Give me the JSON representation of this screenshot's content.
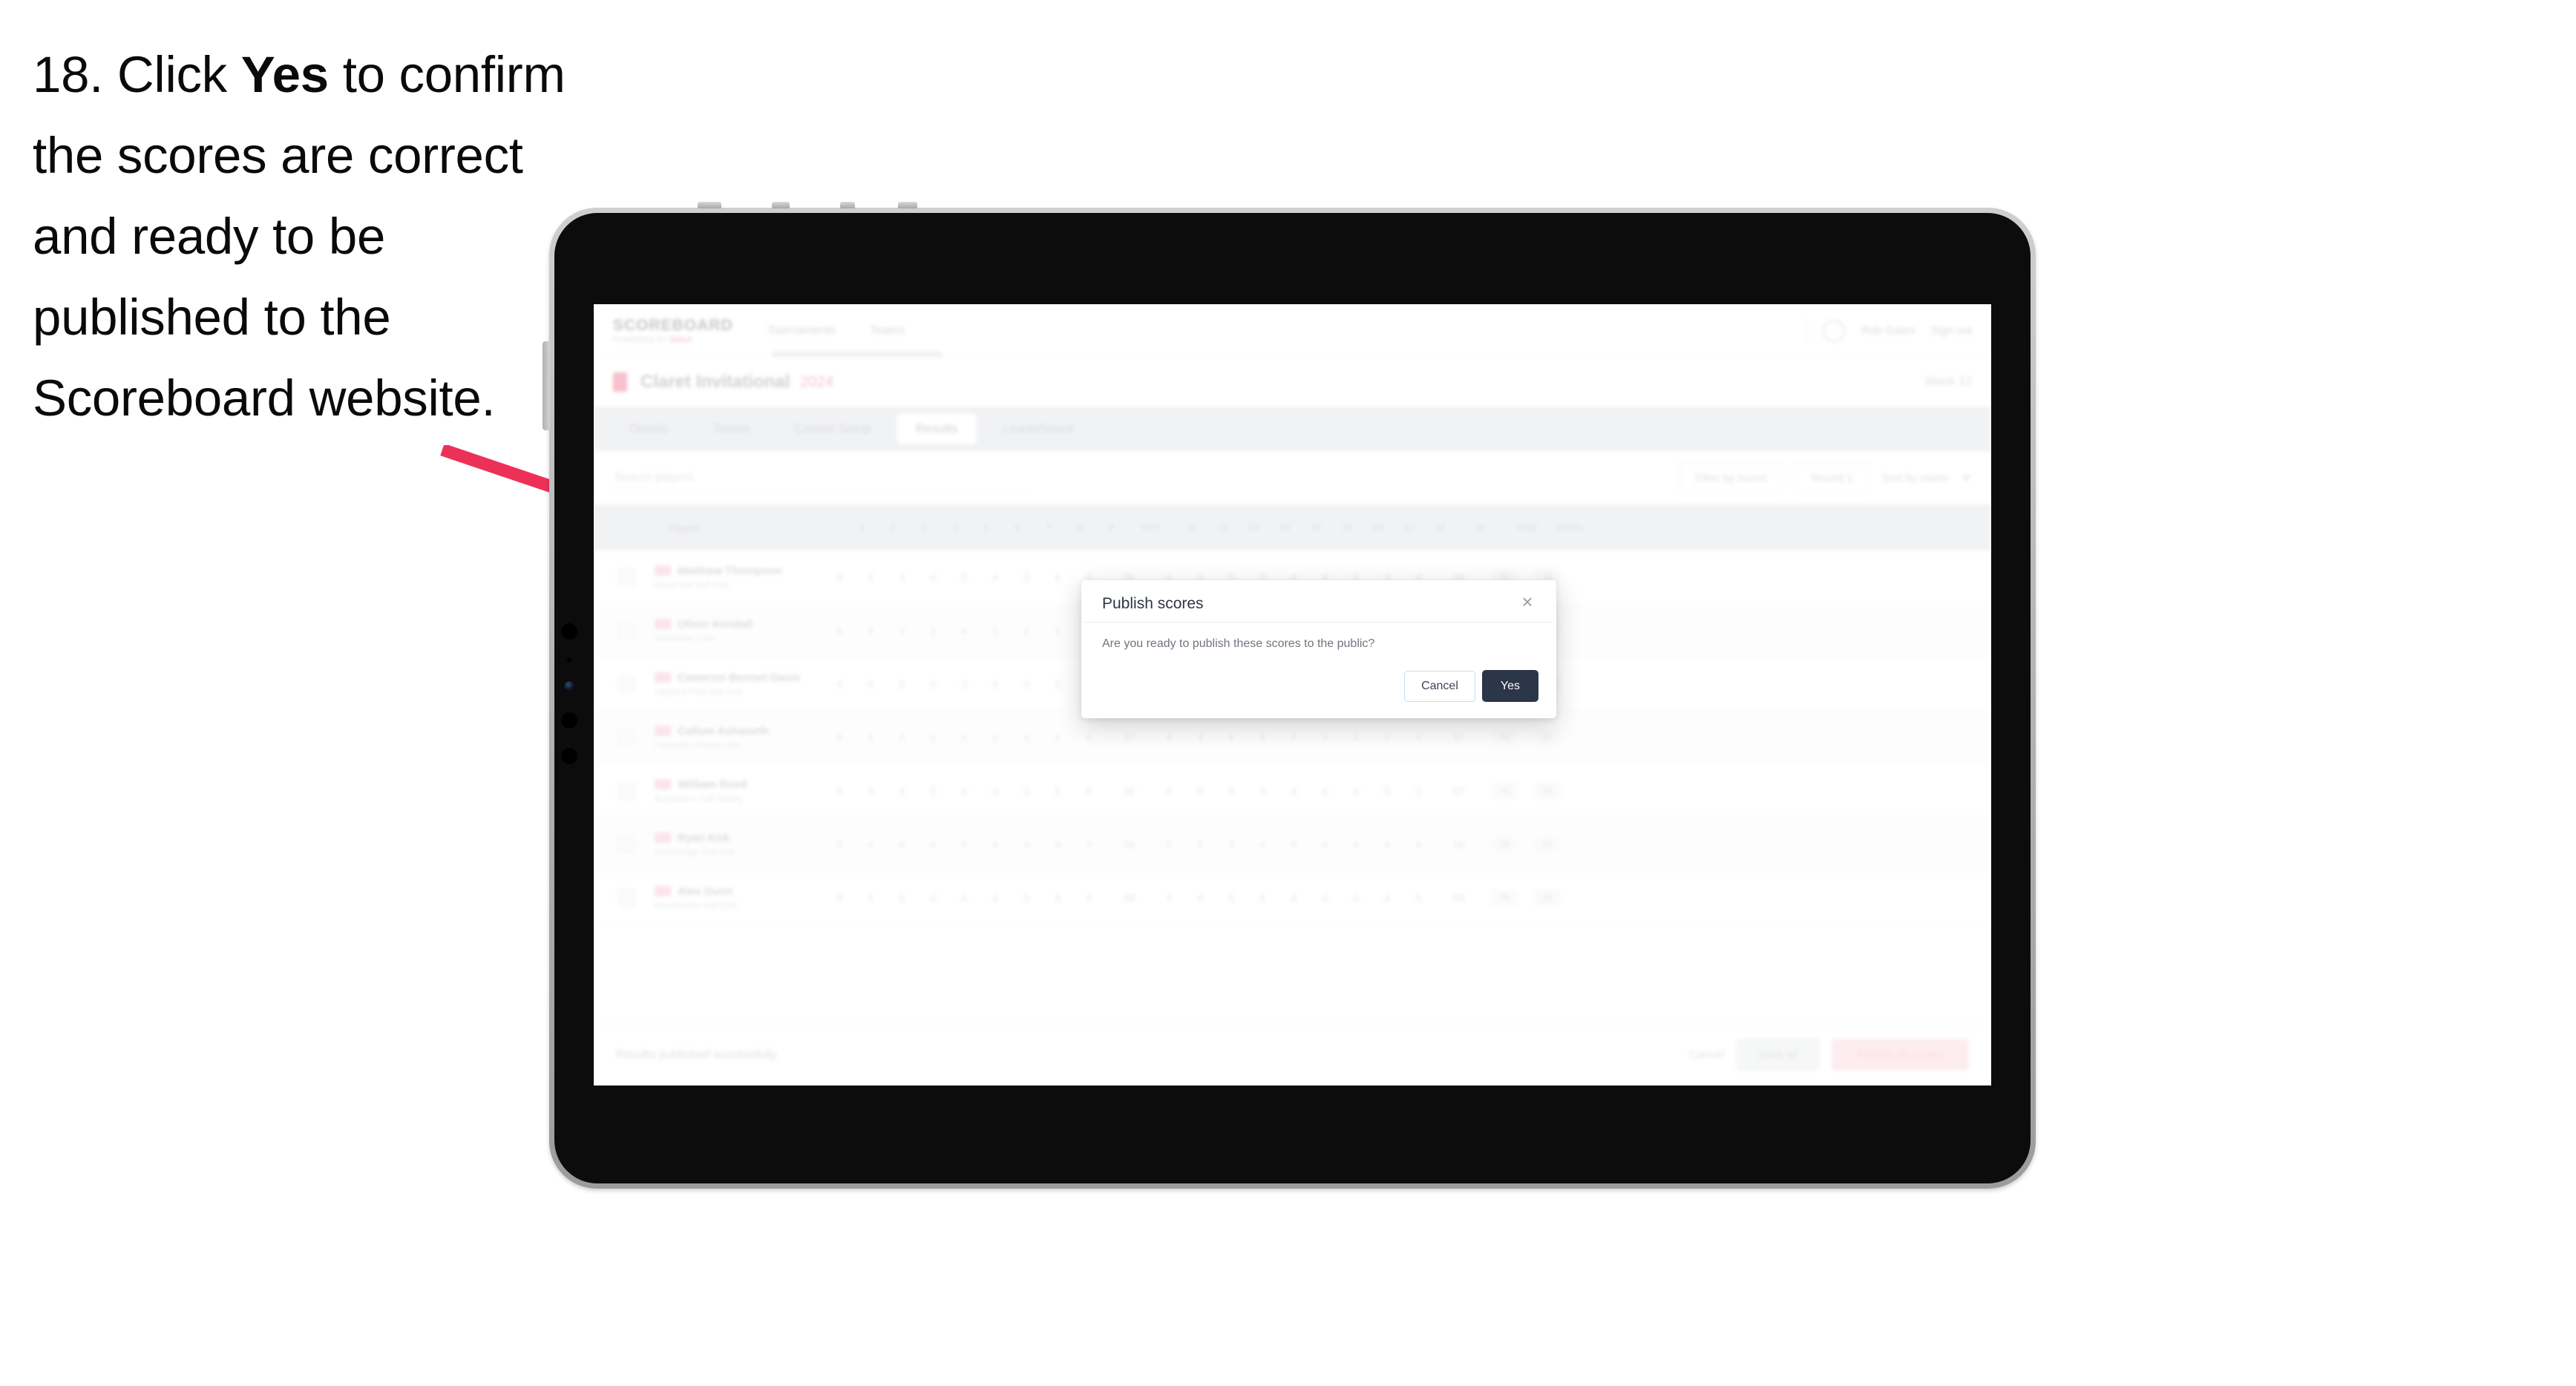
{
  "instruction": {
    "prefix": "18. Click ",
    "bold": "Yes",
    "suffix": " to confirm the scores are correct and ready to be published to the Scoreboard website."
  },
  "annotation": {
    "arrow_color": "#ED3058",
    "arrow_name": "pink-pointer-arrow"
  },
  "device": {
    "frame_color": "#b8b8b8",
    "bezel_color": "#0c0c0c"
  },
  "app": {
    "header": {
      "brand_title": "SCOREBOARD",
      "brand_sub_pre": "POWERED BY ",
      "brand_sub_accent": "GOLF",
      "nav": [
        {
          "label": "Tournaments"
        },
        {
          "label": "Teams"
        }
      ],
      "right": [
        {
          "label": "Rob Gates"
        },
        {
          "label": "Sign out"
        }
      ]
    },
    "event": {
      "name": "Claret Invitational",
      "date": "2024",
      "right_label": "Week 12"
    },
    "tabs": [
      {
        "label": "Details",
        "active": false
      },
      {
        "label": "Teams",
        "active": false
      },
      {
        "label": "Course Setup",
        "active": false
      },
      {
        "label": "Results",
        "active": true
      },
      {
        "label": "Leaderboard",
        "active": false
      }
    ],
    "filters": {
      "search_placeholder": "Search players",
      "select_one": "Filter by round",
      "select_two": "Round 1",
      "sort_label": "Sort by name"
    },
    "table": {
      "columns": [
        {
          "label": "",
          "kind": "sel"
        },
        {
          "label": "Player",
          "kind": "player"
        },
        {
          "label": "1",
          "kind": "hole"
        },
        {
          "label": "2",
          "kind": "hole"
        },
        {
          "label": "3",
          "kind": "hole"
        },
        {
          "label": "4",
          "kind": "hole"
        },
        {
          "label": "5",
          "kind": "hole"
        },
        {
          "label": "6",
          "kind": "hole"
        },
        {
          "label": "7",
          "kind": "hole"
        },
        {
          "label": "8",
          "kind": "hole"
        },
        {
          "label": "9",
          "kind": "hole"
        },
        {
          "label": "OUT",
          "kind": "wide"
        },
        {
          "label": "10",
          "kind": "hole"
        },
        {
          "label": "11",
          "kind": "hole"
        },
        {
          "label": "12",
          "kind": "hole"
        },
        {
          "label": "13",
          "kind": "hole"
        },
        {
          "label": "14",
          "kind": "hole"
        },
        {
          "label": "15",
          "kind": "hole"
        },
        {
          "label": "16",
          "kind": "hole"
        },
        {
          "label": "17",
          "kind": "hole"
        },
        {
          "label": "18",
          "kind": "hole"
        },
        {
          "label": "IN",
          "kind": "wide"
        },
        {
          "label": "Total",
          "kind": "score"
        },
        {
          "label": "Points",
          "kind": "score"
        }
      ],
      "rows": [
        {
          "name": "Matthew Thompson",
          "club": "Royal Oak Golf Club",
          "holes": [
            "4",
            "5",
            "3",
            "4",
            "5",
            "4",
            "3",
            "4",
            "4"
          ],
          "out": "36",
          "holes_in": [
            "4",
            "4",
            "5",
            "3",
            "4",
            "4",
            "5",
            "3",
            "4"
          ],
          "in": "36",
          "total": "72",
          "points": "36"
        },
        {
          "name": "Oliver Kendall",
          "club": "Westbrook Links",
          "holes": [
            "5",
            "4",
            "4",
            "3",
            "4",
            "5",
            "4",
            "3",
            "5"
          ],
          "out": "37",
          "holes_in": [
            "4",
            "5",
            "4",
            "4",
            "3",
            "5",
            "4",
            "4",
            "3"
          ],
          "in": "36",
          "total": "73",
          "points": "34"
        },
        {
          "name": "Cameron Bennet-Davis",
          "club": "Highland Park Golf Club",
          "holes": [
            "4",
            "4",
            "5",
            "4",
            "3",
            "4",
            "4",
            "5",
            "4"
          ],
          "out": "37",
          "holes_in": [
            "5",
            "4",
            "3",
            "4",
            "4",
            "4",
            "5",
            "4",
            "4"
          ],
          "in": "37",
          "total": "74",
          "points": "32"
        },
        {
          "name": "Callum Ashworth",
          "club": "Fairhaven Country Club",
          "holes": [
            "3",
            "5",
            "4",
            "4",
            "4",
            "5",
            "4",
            "4",
            "4"
          ],
          "out": "37",
          "holes_in": [
            "4",
            "4",
            "4",
            "5",
            "4",
            "3",
            "4",
            "5",
            "4"
          ],
          "in": "37",
          "total": "74",
          "points": "31"
        },
        {
          "name": "William Reed",
          "club": "Brambleton Golf Society",
          "holes": [
            "4",
            "4",
            "4",
            "5",
            "4",
            "4",
            "3",
            "5",
            "5"
          ],
          "out": "38",
          "holes_in": [
            "4",
            "5",
            "4",
            "4",
            "4",
            "4",
            "4",
            "5",
            "3"
          ],
          "in": "37",
          "total": "75",
          "points": "29"
        },
        {
          "name": "Ryan Kirk",
          "club": "Stonebridge Golf Club",
          "holes": [
            "5",
            "4",
            "4",
            "4",
            "5",
            "4",
            "4",
            "4",
            "4"
          ],
          "out": "38",
          "holes_in": [
            "5",
            "4",
            "4",
            "4",
            "5",
            "4",
            "4",
            "4",
            "4"
          ],
          "in": "38",
          "total": "76",
          "points": "27"
        },
        {
          "name": "Alex Dunn",
          "club": "Meadowvale Golf Club",
          "holes": [
            "4",
            "5",
            "5",
            "4",
            "4",
            "4",
            "5",
            "4",
            "4"
          ],
          "out": "39",
          "holes_in": [
            "4",
            "4",
            "5",
            "5",
            "4",
            "4",
            "4",
            "4",
            "5"
          ],
          "in": "39",
          "total": "78",
          "points": "25"
        }
      ]
    },
    "bottom": {
      "note": "Results published successfully",
      "link": "Cancel",
      "secondary": "Save all",
      "primary": "Publish all scores"
    }
  },
  "modal": {
    "title": "Publish scores",
    "message": "Are you ready to publish these scores to the public?",
    "close_icon": "×",
    "cancel_label": "Cancel",
    "confirm_label": "Yes",
    "confirm_color": "#2b3648",
    "cancel_border_color": "#c9daf3"
  }
}
